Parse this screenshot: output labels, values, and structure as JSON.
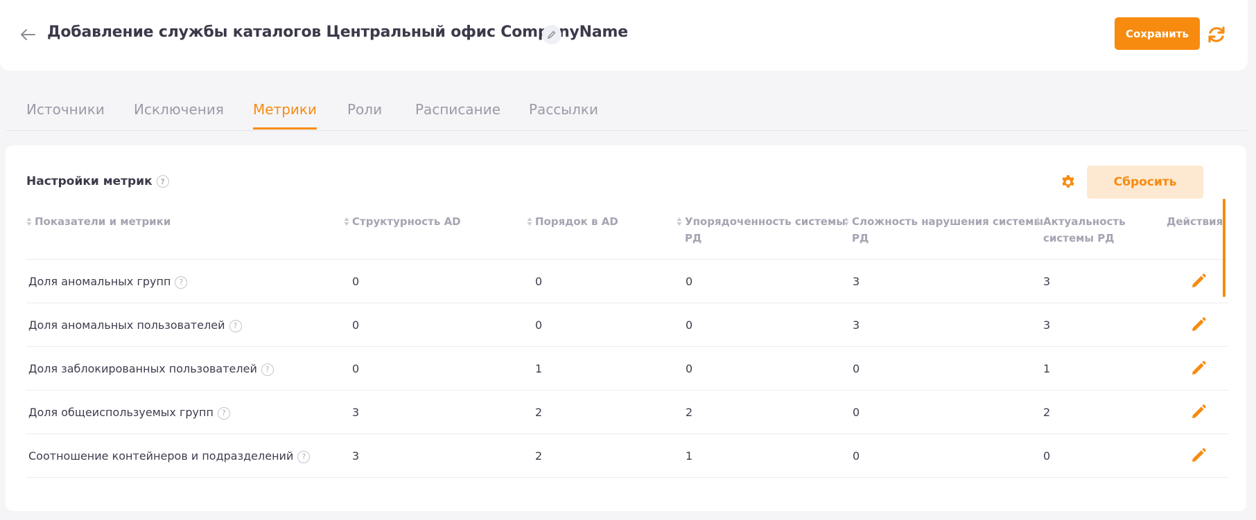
{
  "header": {
    "title": "Добавление службы каталогов Центральный офис CompanyName",
    "save_label": "Сохранить"
  },
  "tabs": [
    {
      "label": "Источники",
      "active": false
    },
    {
      "label": "Исключения",
      "active": false
    },
    {
      "label": "Метрики",
      "active": true
    },
    {
      "label": "Роли",
      "active": false
    },
    {
      "label": "Расписание",
      "active": false
    },
    {
      "label": "Рассылки",
      "active": false
    }
  ],
  "settings": {
    "title": "Настройки метрик",
    "reset_label": "Сбросить"
  },
  "table": {
    "columns": [
      {
        "label": "Показатели и метрики",
        "line1": "Показатели и метрики",
        "line2": ""
      },
      {
        "label": "Структурность AD",
        "line1": "Структурность AD",
        "line2": ""
      },
      {
        "label": "Порядок в AD",
        "line1": "Порядок в AD",
        "line2": ""
      },
      {
        "label": "Упорядоченность системы РД",
        "line1": "Упорядоченность системы",
        "line2": "РД"
      },
      {
        "label": "Сложность нарушения системы РД",
        "line1": "Сложность нарушения системы",
        "line2": "РД"
      },
      {
        "label": "Актуальность системы РД",
        "line1": "Актуальность",
        "line2": "системы РД"
      },
      {
        "label": "Действия",
        "line1": "Действия",
        "line2": ""
      }
    ],
    "rows": [
      {
        "name": "Доля аномальных групп",
        "values": [
          "0",
          "0",
          "0",
          "3",
          "3"
        ]
      },
      {
        "name": "Доля аномальных пользователей",
        "values": [
          "0",
          "0",
          "0",
          "3",
          "3"
        ]
      },
      {
        "name": "Доля заблокированных пользователей",
        "values": [
          "0",
          "1",
          "0",
          "0",
          "1"
        ]
      },
      {
        "name": "Доля общеиспользуемых групп",
        "values": [
          "3",
          "2",
          "2",
          "0",
          "2"
        ]
      },
      {
        "name": "Соотношение контейнеров и подразделений",
        "values": [
          "3",
          "2",
          "1",
          "0",
          "0"
        ]
      }
    ]
  },
  "colors": {
    "accent": "#f78b10",
    "accent_light": "#fde9d2",
    "muted_text": "#a4a4b2"
  },
  "icons": [
    "back-arrow-icon",
    "pencil-icon",
    "refresh-icon",
    "gear-icon",
    "help-icon",
    "sort-icon",
    "edit-icon"
  ]
}
